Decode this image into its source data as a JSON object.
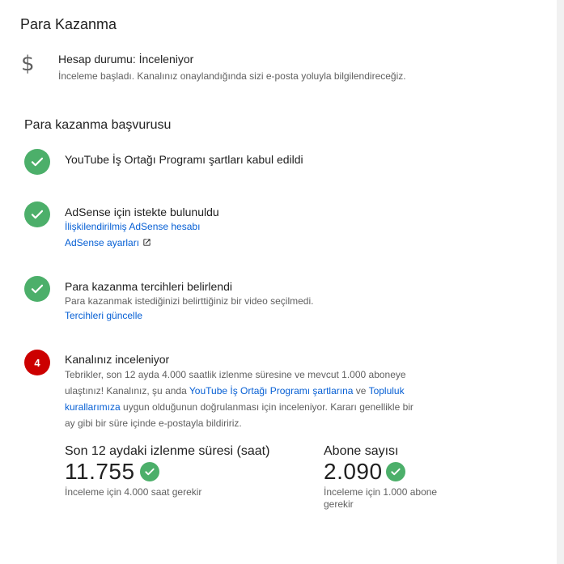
{
  "page": {
    "title": "Para Kazanma"
  },
  "account": {
    "icon": "dollar-icon",
    "status": "Hesap durumu: İnceleniyor",
    "description": "İnceleme başladı. Kanalınız onaylandığında sizi e-posta yoluyla bilgilendireceğiz."
  },
  "application": {
    "title": "Para kazanma başvurusu",
    "steps": [
      {
        "state": "done",
        "title": "YouTube İş Ortağı Programı şartları kabul edildi"
      },
      {
        "state": "done",
        "title": "AdSense için istekte bulunuldu",
        "link1": "İlişkilendirilmiş AdSense hesabı",
        "link2": "AdSense ayarları"
      },
      {
        "state": "done",
        "title": "Para kazanma tercihleri belirlendi",
        "desc": "Para kazanmak istediğinizi belirttiğiniz bir video seçilmedi.",
        "link1": "Tercihleri güncelle"
      },
      {
        "state": "active",
        "number": "4",
        "title": "Kanalınız inceleniyor",
        "desc_line1": "Tebrikler, son 12 ayda 4.000 saatlik izlenme süresine ve mevcut 1.000 aboneye",
        "desc_line2_a": "ulaştınız! Kanalınız, şu anda ",
        "desc_line2_link1": "YouTube İş Ortağı Programı şartlarına",
        "desc_line2_b": " ve ",
        "desc_line2_link2": "Topluluk",
        "desc_line3_link2": "kurallarımıza",
        "desc_line3_b": " uygun olduğunun doğrulanması için inceleniyor. Kararı genellikle bir",
        "desc_line4": "ay gibi bir süre içinde e-postayla bildiririz."
      }
    ]
  },
  "stats": {
    "watch_time": {
      "label": "Son 12 aydaki izlenme süresi (saat)",
      "value": "11.755",
      "requirement": "İnceleme için 4.000 saat gerekir"
    },
    "subscribers": {
      "label": "Abone sayısı",
      "value": "2.090",
      "requirement_line1": "İnceleme için 1.000 abone",
      "requirement_line2": "gerekir"
    }
  },
  "colors": {
    "success": "#4caf6a",
    "active": "#cc0000",
    "link": "#065fd4"
  }
}
